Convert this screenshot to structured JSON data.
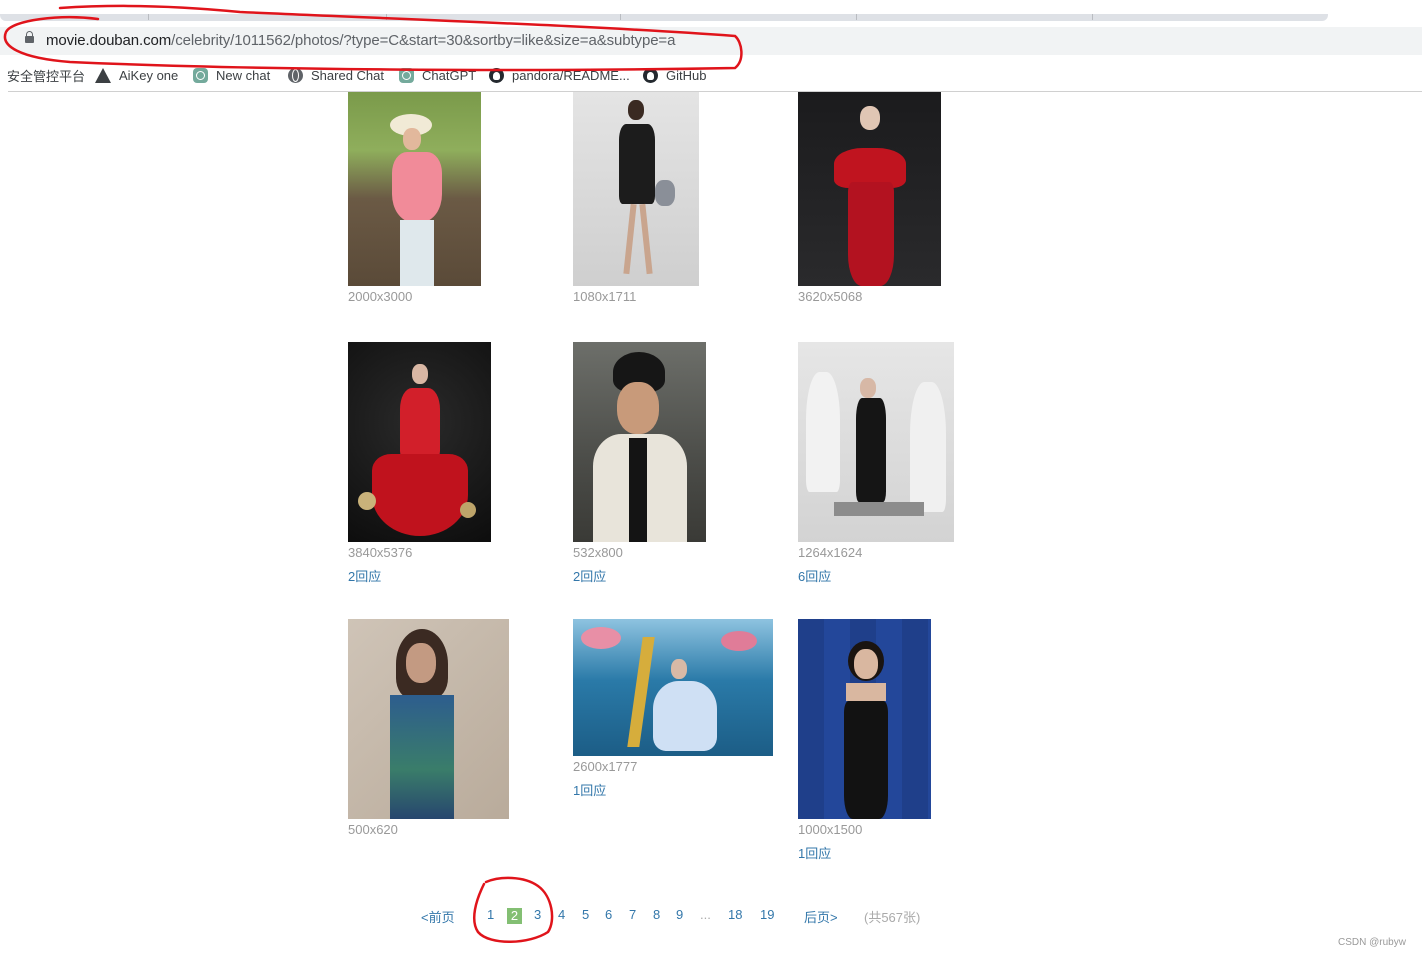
{
  "browser": {
    "url_host": "movie.douban.com",
    "url_path": "/celebrity/1011562/photos/?type=C&start=30&sortby=like&size=a&subtype=a",
    "bookmarks": [
      "安全管控平台",
      "AiKey one",
      "New chat",
      "Shared Chat",
      "ChatGPT",
      "pandora/README...",
      "GitHub"
    ],
    "bookmark_icons": [
      "",
      "aikey-icon",
      "chatgpt-icon",
      "globe-icon",
      "chatgpt-icon",
      "github-icon",
      "github-icon"
    ]
  },
  "photos": [
    {
      "size": "2000x3000",
      "replies": ""
    },
    {
      "size": "1080x1711",
      "replies": ""
    },
    {
      "size": "3620x5068",
      "replies": ""
    },
    {
      "size": "3840x5376",
      "replies": "2回应"
    },
    {
      "size": "532x800",
      "replies": "2回应"
    },
    {
      "size": "1264x1624",
      "replies": "6回应"
    },
    {
      "size": "500x620",
      "replies": ""
    },
    {
      "size": "2600x1777",
      "replies": "1回应"
    },
    {
      "size": "1000x1500",
      "replies": "1回应"
    }
  ],
  "pagination": {
    "prev": "<前页",
    "pages": [
      "1",
      "2",
      "3",
      "4",
      "5",
      "6",
      "7",
      "8",
      "9"
    ],
    "current": "2",
    "ellipsis": "...",
    "last_pages": [
      "18",
      "19"
    ],
    "next": "后页>",
    "total": "(共567张)"
  },
  "watermark": "CSDN @rubyw",
  "annotation_color": "#e0141b"
}
